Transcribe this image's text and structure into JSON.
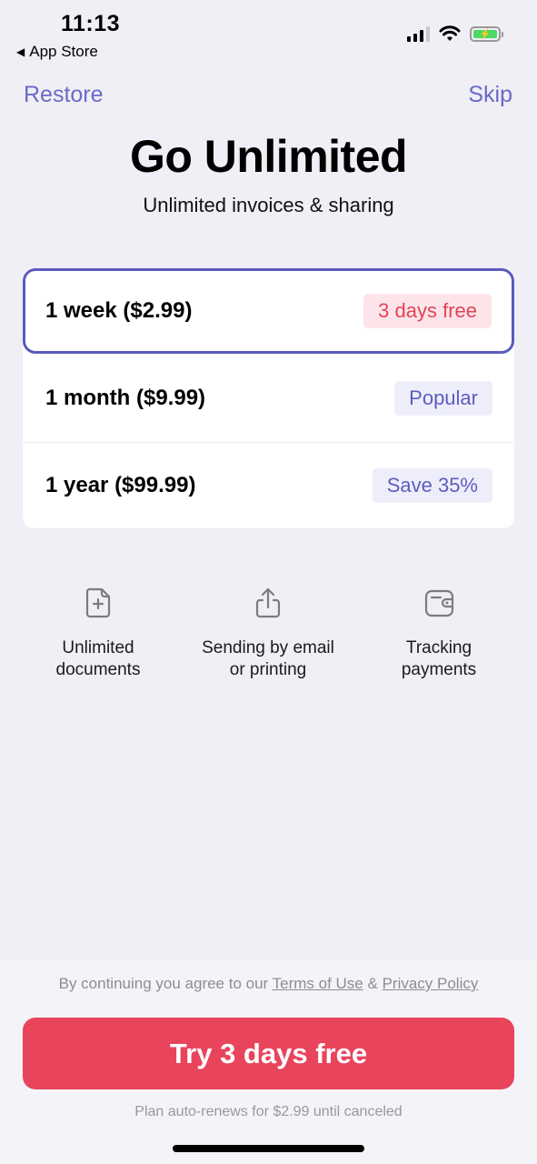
{
  "status_bar": {
    "time": "11:13",
    "back_app": "App Store",
    "icons": [
      "cellular-signal-icon",
      "wifi-icon",
      "battery-charging-icon"
    ]
  },
  "nav": {
    "restore_label": "Restore",
    "skip_label": "Skip"
  },
  "header": {
    "title": "Go Unlimited",
    "subtitle": "Unlimited invoices & sharing"
  },
  "plans": [
    {
      "label": "1 week ($2.99)",
      "badge": "3 days free",
      "selected": true
    },
    {
      "label": "1 month ($9.99)",
      "badge": "Popular",
      "selected": false
    },
    {
      "label": "1 year ($99.99)",
      "badge": "Save 35%",
      "selected": false
    }
  ],
  "features": [
    {
      "icon": "document-add-icon",
      "line1": "Unlimited",
      "line2": "documents"
    },
    {
      "icon": "share-icon",
      "line1": "Sending by email",
      "line2": "or printing"
    },
    {
      "icon": "wallet-icon",
      "line1": "Tracking",
      "line2": "payments"
    }
  ],
  "footer": {
    "legal_prefix": "By continuing you agree to our ",
    "terms_label": "Terms of Use",
    "legal_and": " & ",
    "privacy_label": "Privacy Policy",
    "cta_label": "Try 3 days free",
    "renew_text": "Plan auto-renews for $2.99 until canceled"
  },
  "colors": {
    "accent": "#6a6ac9",
    "selected_border": "#5b5bbd",
    "cta": "#e8445c",
    "badge_red_bg": "#fde4e8",
    "badge_blue_bg": "#eeeefb"
  }
}
